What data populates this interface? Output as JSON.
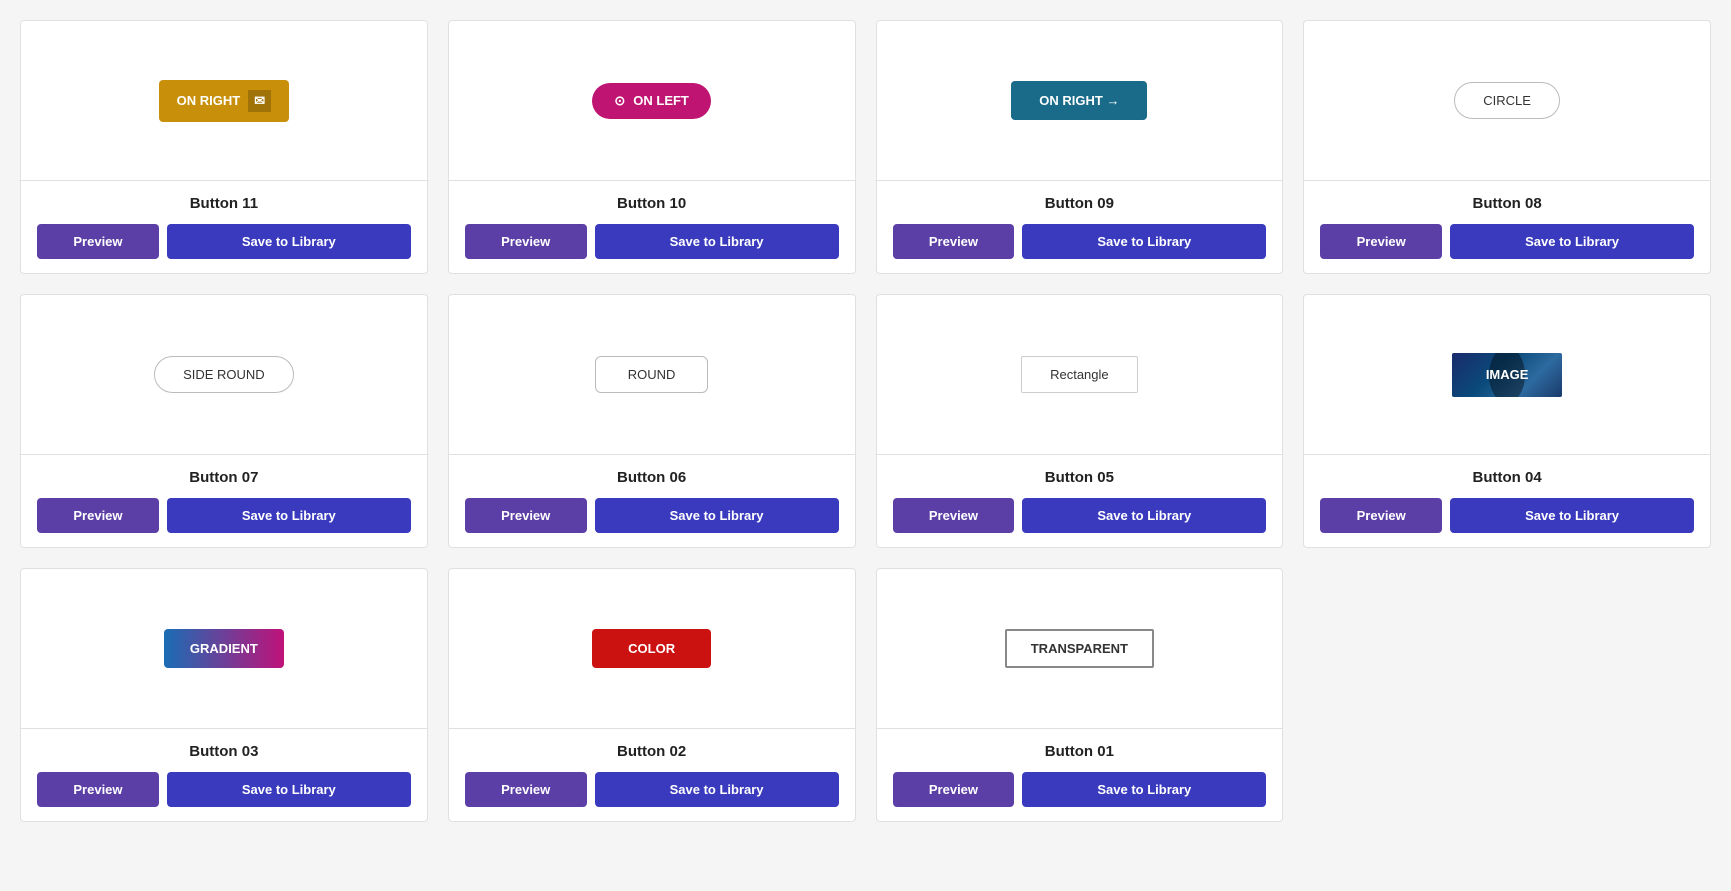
{
  "cards": [
    {
      "id": "btn11",
      "title": "Button 11",
      "type": "on-right",
      "preview_label": "ON RIGHT",
      "preview_actions": "save_library"
    },
    {
      "id": "btn10",
      "title": "Button 10",
      "type": "on-left",
      "preview_label": "ON LEFT",
      "preview_actions": "save_library"
    },
    {
      "id": "btn09",
      "title": "Button 09",
      "type": "on-right-arrow",
      "preview_label": "ON RIGHT →",
      "preview_actions": "save_library"
    },
    {
      "id": "btn08",
      "title": "Button 08",
      "type": "circle",
      "preview_label": "CIRCLE",
      "preview_actions": "save_library"
    },
    {
      "id": "btn07",
      "title": "Button 07",
      "type": "side-round",
      "preview_label": "SIDE ROUND",
      "preview_actions": "save_library"
    },
    {
      "id": "btn06",
      "title": "Button 06",
      "type": "round",
      "preview_label": "ROUND",
      "preview_actions": "save_library"
    },
    {
      "id": "btn05",
      "title": "Button 05",
      "type": "rectangle",
      "preview_label": "Rectangle",
      "preview_actions": "save_library"
    },
    {
      "id": "btn04",
      "title": "Button 04",
      "type": "image",
      "preview_label": "IMAGE",
      "preview_actions": "save_library"
    },
    {
      "id": "btn03",
      "title": "Button 03",
      "type": "gradient",
      "preview_label": "GRADIENT",
      "preview_actions": "save_library"
    },
    {
      "id": "btn02",
      "title": "Button 02",
      "type": "color",
      "preview_label": "COLOR",
      "preview_actions": "save_library"
    },
    {
      "id": "btn01",
      "title": "Button 01",
      "type": "transparent",
      "preview_label": "TRANSPARENT",
      "preview_actions": "save_library"
    }
  ],
  "actions": {
    "preview": "Preview",
    "save": "Save to Library"
  },
  "icons": {
    "email": "✉",
    "play": "⊙",
    "arrow": "→"
  }
}
